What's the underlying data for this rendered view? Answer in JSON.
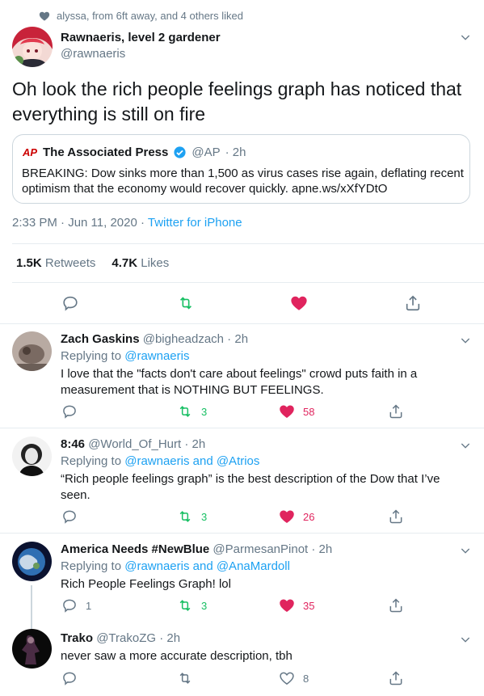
{
  "social_context": "alyssa, from 6ft away, and 4 others liked",
  "tweet": {
    "name": "Rawnaeris, level 2 gardener",
    "handle": "@rawnaeris",
    "text": "Oh look the rich people feelings graph has noticed that everything is still on fire",
    "quote": {
      "logo": "AP",
      "name": "The Associated Press",
      "handle": "@AP",
      "time": "· 2h",
      "text": "BREAKING: Dow sinks more than 1,500 as virus cases rise again, deflating recent optimism that the economy would recover quickly. apne.ws/xXfYDtO"
    },
    "timestamp": "2:33 PM · Jun 11, 2020 · ",
    "source": "Twitter for iPhone",
    "retweets_count": "1.5K",
    "retweets_label": "Retweets",
    "likes_count": "4.7K",
    "likes_label": "Likes"
  },
  "replies": [
    {
      "name": "Zach Gaskins",
      "handle": "@bigheadzach · 2h",
      "replying_prefix": "Replying to ",
      "replying_to": "@rawnaeris",
      "text": "I love that the \"facts don't care about feelings\" crowd puts faith in a measurement that is NOTHING BUT FEELINGS.",
      "replies": "",
      "retweets": "3",
      "likes": "58"
    },
    {
      "name": "8:46",
      "handle": "@World_Of_Hurt · 2h",
      "replying_prefix": "Replying to ",
      "replying_to": "@rawnaeris and @Atrios",
      "text": "“Rich people feelings graph” is the best description of the Dow that I’ve seen.",
      "replies": "",
      "retweets": "3",
      "likes": "26"
    },
    {
      "name": "America Needs #NewBlue",
      "handle": "@ParmesanPinot · 2h",
      "replying_prefix": "Replying to ",
      "replying_to": "@rawnaeris and @AnaMardoll",
      "text": "Rich People Feelings Graph! lol",
      "replies": "1",
      "retweets": "3",
      "likes": "35"
    },
    {
      "name": "Trako",
      "handle": "@TrakoZG · 2h",
      "text": "never saw a more accurate description, tbh",
      "replies": "",
      "retweets": "",
      "likes": "8"
    }
  ],
  "colors": {
    "accent": "#1da1f2",
    "retweet": "#17bf63",
    "like": "#e0245e",
    "muted": "#657786"
  }
}
